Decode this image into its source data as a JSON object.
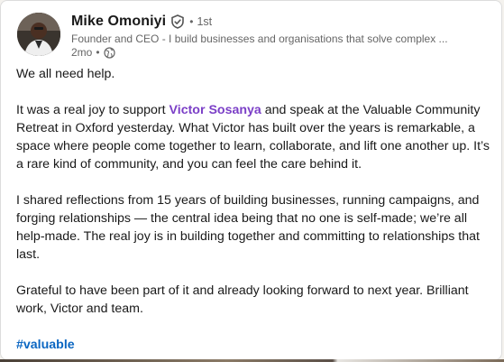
{
  "author": {
    "name": "Mike Omoniyi",
    "connection_degree": "1st",
    "headline": "Founder and CEO - I build businesses and organisations that solve complex ...",
    "post_age": "2mo",
    "verified_icon": "verified-shield-icon",
    "visibility_icon": "globe-icon"
  },
  "post": {
    "para1": "We all need help.",
    "para2_before": "It was a real joy to support ",
    "para2_mention": "Victor Sosanya",
    "para2_after": " and speak at the Valuable Community Retreat in Oxford yesterday. What Victor has built over the years is remarkable, a space where people come together to learn, collaborate, and lift one another up. It’s a rare kind of community, and you can feel the care behind it.",
    "para3": "I shared reflections from 15 years of building businesses, running campaigns, and forging relationships — the central idea being that no one is self-made; we’re all help-made. The real joy is in building together and committing to relationships that last.",
    "para4": "Grateful to have been part of it and already looking forward to next year. Brilliant work, Victor and team.",
    "hashtag": "#valuable"
  },
  "colors": {
    "mention": "#7b3fc7",
    "hashtag": "#0a66c2",
    "text": "#191919",
    "muted": "#666666"
  }
}
